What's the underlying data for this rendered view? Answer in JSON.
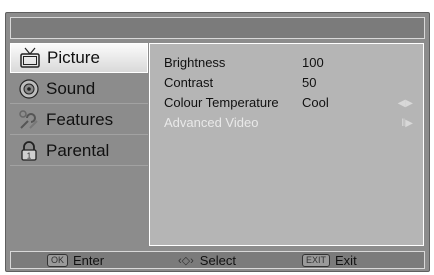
{
  "menu": {
    "items": [
      {
        "label": "Picture",
        "icon": "tv-icon",
        "selected": true
      },
      {
        "label": "Sound",
        "icon": "speaker-icon",
        "selected": false
      },
      {
        "label": "Features",
        "icon": "features-icon",
        "selected": false
      },
      {
        "label": "Parental",
        "icon": "lock-icon",
        "selected": false
      }
    ]
  },
  "settings": {
    "rows": [
      {
        "label": "Brightness",
        "value": "100"
      },
      {
        "label": "Contrast",
        "value": "50"
      },
      {
        "label": "Colour Temperature",
        "value": "Cool"
      },
      {
        "label": "Advanced Video",
        "value": ""
      }
    ]
  },
  "footer": {
    "enter_key": "OK",
    "enter_label": "Enter",
    "select_label": "Select",
    "exit_key": "EXIT",
    "exit_label": "Exit"
  }
}
